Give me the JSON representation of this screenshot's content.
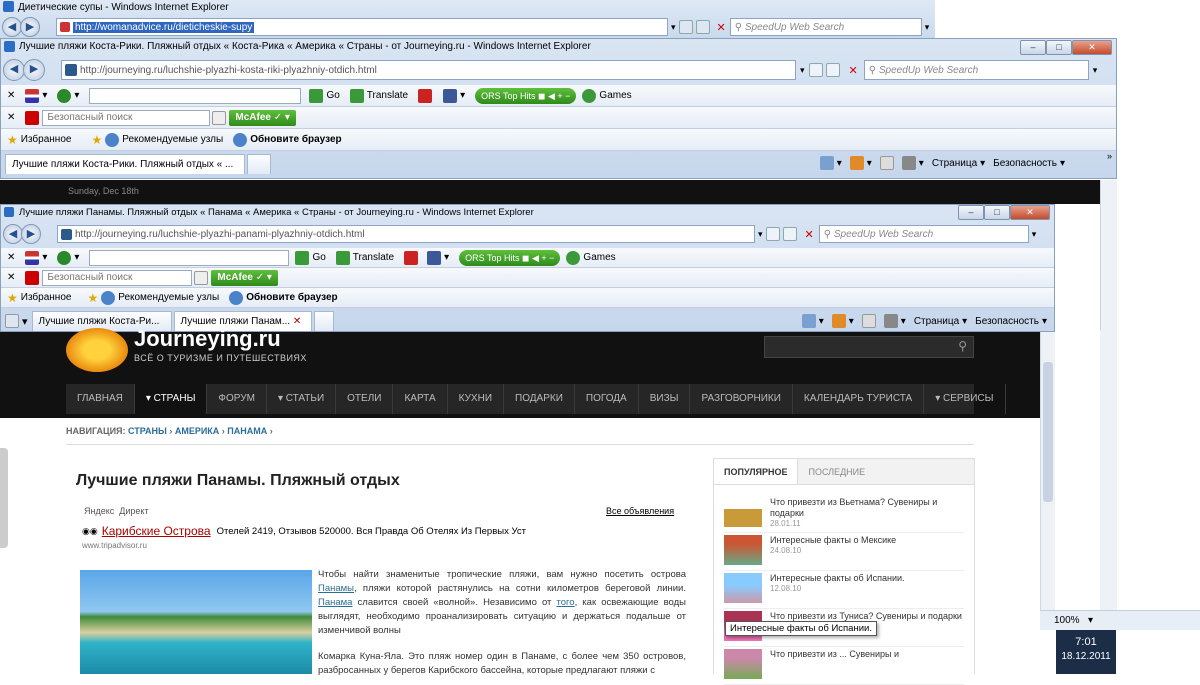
{
  "win_back": {
    "title": "Диетические супы - Windows Internet Explorer",
    "url": "http://womanadvice.ru/dieticheskie-supy",
    "search_placeholder": "SpeedUp Web Search"
  },
  "win_mid": {
    "title": "Лучшие пляжи Коста-Рики. Пляжный отдых « Коста-Рика « Америка « Страны - от Journeying.ru - Windows Internet Explorer",
    "url": "http://journeying.ru/luchshie-plyazhi-kosta-riki-plyazhniy-otdich.html",
    "search_placeholder": "SpeedUp Web Search",
    "toolbar": {
      "go": "Go",
      "translate": "Translate",
      "ors": "ORS Top Hits",
      "games": "Games"
    },
    "mcafee": {
      "search_placeholder": "Безопасный поиск",
      "brand": "McAfee"
    },
    "fav": {
      "izbrannoe": "Избранное",
      "recommended": "Рекомендуемые узлы",
      "update": "Обновите браузер"
    },
    "tab": "Лучшие пляжи Коста-Рики. Пляжный отдых « ...",
    "menu": {
      "page": "Страница",
      "safety": "Безопасность"
    },
    "date_strip": "Sunday, Dec 18th"
  },
  "win_front": {
    "title": "Лучшие пляжи Панамы. Пляжный отдых « Панама « Америка « Страны - от Journeying.ru - Windows Internet Explorer",
    "url": "http://journeying.ru/luchshie-plyazhi-panami-plyazhniy-otdich.html",
    "search_placeholder": "SpeedUp Web Search",
    "toolbar": {
      "go": "Go",
      "translate": "Translate",
      "ors": "ORS Top Hits",
      "games": "Games"
    },
    "mcafee": {
      "search_placeholder": "Безопасный поиск",
      "brand": "McAfee"
    },
    "fav": {
      "izbrannoe": "Избранное",
      "recommended": "Рекомендуемые узлы",
      "update": "Обновите браузер"
    },
    "tabs": [
      "Лучшие пляжи Коста-Ри...",
      "Лучшие пляжи Панам..."
    ],
    "menu": {
      "page": "Страница",
      "safety": "Безопасность"
    }
  },
  "site": {
    "logo": "Journeying.ru",
    "tagline": "ВСЁ О ТУРИЗМЕ И ПУТЕШЕСТВИЯХ",
    "nav": [
      "ГЛАВНАЯ",
      "▾ СТРАНЫ",
      "ФОРУМ",
      "▾ СТАТЬИ",
      "ОТЕЛИ",
      "КАРТА",
      "КУХНИ",
      "ПОДАРКИ",
      "ПОГОДА",
      "ВИЗЫ",
      "РАЗГОВОРНИКИ",
      "КАЛЕНДАРЬ ТУРИСТА",
      "▾ СЕРВИСЫ"
    ],
    "crumb": {
      "prefix": "НАВИГАЦИЯ:",
      "c1": "СТРАНЫ",
      "c2": "АМЕРИКА",
      "c3": "ПАНАМА"
    },
    "heading": "Лучшие пляжи Панамы. Пляжный отдых",
    "ad": {
      "yandex": "Яндекс",
      "direct": "Директ",
      "all": "Все объявления",
      "title": "Карибские Острова",
      "desc": "Отелей 2419, Отзывов 520000. Вся Правда Об Отелях Из Первых Уст",
      "domain": "www.tripadvisor.ru"
    },
    "p1a": "Чтобы найти знаменитые тропические пляжи, вам нужно посетить острова ",
    "p1_link1": "Панамы",
    "p1b": ", пляжи которой растянулись на сотни километров береговой линии. ",
    "p1_link2": "Панама",
    "p1c": " славится своей «волной». Независимо от ",
    "p1_link3": "того",
    "p1d": ", как освежающие воды выглядят, необходимо проанализировать ситуацию и держаться подальше от изменчивой волны",
    "p2": "Комарка Куна-Яла. Это пляж номер один в Панаме, с более чем 350 островов, разбросанных у берегов Карибского бассейна, которые предлагают пляжи с",
    "side_tabs": [
      "ПОПУЛЯРНОЕ",
      "ПОСЛЕДНИЕ"
    ],
    "side_items": [
      {
        "t": "Что привезти из Вьетнама? Сувениры и подарки",
        "d": "28.01.11"
      },
      {
        "t": "Интересные факты о Мексике",
        "d": "24.08.10"
      },
      {
        "t": "Интересные факты об Испании.",
        "d": "12.08.10"
      },
      {
        "t": "Что привезти из Туниса? Сувениры и подарки",
        "d": "28.01.11"
      },
      {
        "t": "Что привезти из ... Сувениры и",
        "d": ""
      }
    ],
    "tooltip": "Интересные факты об Испании."
  },
  "status": {
    "zoom": "100%",
    "time": "7:01",
    "date": "18.12.2011"
  }
}
